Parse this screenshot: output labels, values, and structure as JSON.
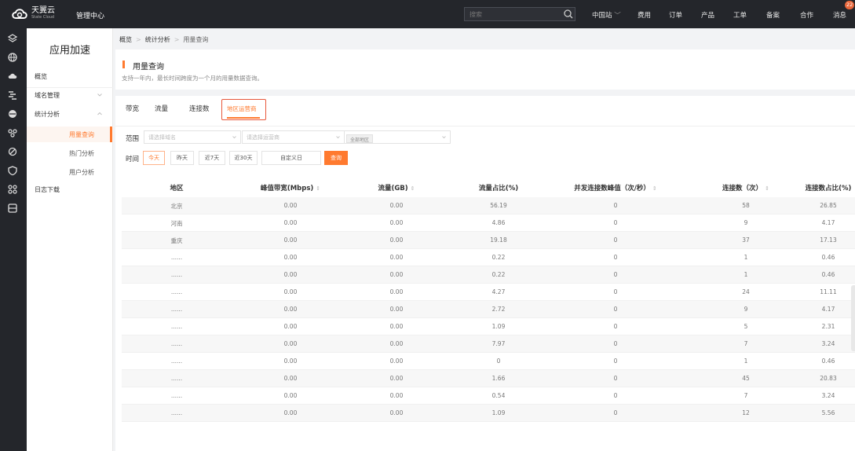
{
  "topbar": {
    "logo_cn": "天翼云",
    "logo_en": "State Cloud",
    "mgmt_label": "管理中心",
    "search_placeholder": "搜索",
    "region": "中国站",
    "nav": [
      "费用",
      "订单",
      "产品",
      "工单",
      "备案",
      "合作",
      "消息"
    ],
    "badge": "22"
  },
  "sidebar": {
    "title": "应用加速",
    "items": [
      {
        "label": "概览"
      },
      {
        "label": "域名管理"
      },
      {
        "label": "统计分析"
      },
      {
        "label": "日志下载"
      }
    ],
    "sub_items": [
      {
        "label": "用量查询"
      },
      {
        "label": "热门分析"
      },
      {
        "label": "用户分析"
      }
    ]
  },
  "breadcrumb": [
    "概览",
    "统计分析",
    "用量查询"
  ],
  "section": {
    "title": "用量查询",
    "desc": "支持一年内，最长时间跨度为一个月的用量数据查询。"
  },
  "tabs": [
    "带宽",
    "流量",
    "连接数",
    "地区运营商"
  ],
  "filters": {
    "range_label": "范围",
    "domain_placeholder": "请选择域名",
    "isp_placeholder": "请选择运营商",
    "area_tag": "全部地区",
    "time_label": "时间",
    "time_buttons": [
      "今天",
      "昨天",
      "近7天",
      "近30天",
      "自定义日"
    ],
    "query_label": "查询"
  },
  "table": {
    "headers": [
      "地区",
      "峰值带宽(Mbps)",
      "流量(GB)",
      "流量占比(%)",
      "并发连接数峰值（次/秒）",
      "连接数（次）",
      "连接数占比(%)"
    ],
    "rows": [
      [
        "北京",
        "0.00",
        "0.00",
        "56.19",
        "0",
        "58",
        "26.85"
      ],
      [
        "河南",
        "0.00",
        "0.00",
        "4.86",
        "0",
        "9",
        "4.17"
      ],
      [
        "重庆",
        "0.00",
        "0.00",
        "19.18",
        "0",
        "37",
        "17.13"
      ],
      [
        "......",
        "0.00",
        "0.00",
        "0.22",
        "0",
        "1",
        "0.46"
      ],
      [
        "......",
        "0.00",
        "0.00",
        "0.22",
        "0",
        "1",
        "0.46"
      ],
      [
        "......",
        "0.00",
        "0.00",
        "4.27",
        "0",
        "24",
        "11.11"
      ],
      [
        "......",
        "0.00",
        "0.00",
        "2.72",
        "0",
        "9",
        "4.17"
      ],
      [
        "......",
        "0.00",
        "0.00",
        "1.09",
        "0",
        "5",
        "2.31"
      ],
      [
        "......",
        "0.00",
        "0.00",
        "7.97",
        "0",
        "7",
        "3.24"
      ],
      [
        "......",
        "0.00",
        "0.00",
        "0",
        "0",
        "1",
        "0.46"
      ],
      [
        "......",
        "0.00",
        "0.00",
        "1.66",
        "0",
        "45",
        "20.83"
      ],
      [
        "......",
        "0.00",
        "0.00",
        "0.54",
        "0",
        "7",
        "3.24"
      ],
      [
        "......",
        "0.00",
        "0.00",
        "1.09",
        "0",
        "12",
        "5.56"
      ]
    ]
  },
  "colors": {
    "accent": "#ff7a2f",
    "topbar": "#24262b"
  }
}
